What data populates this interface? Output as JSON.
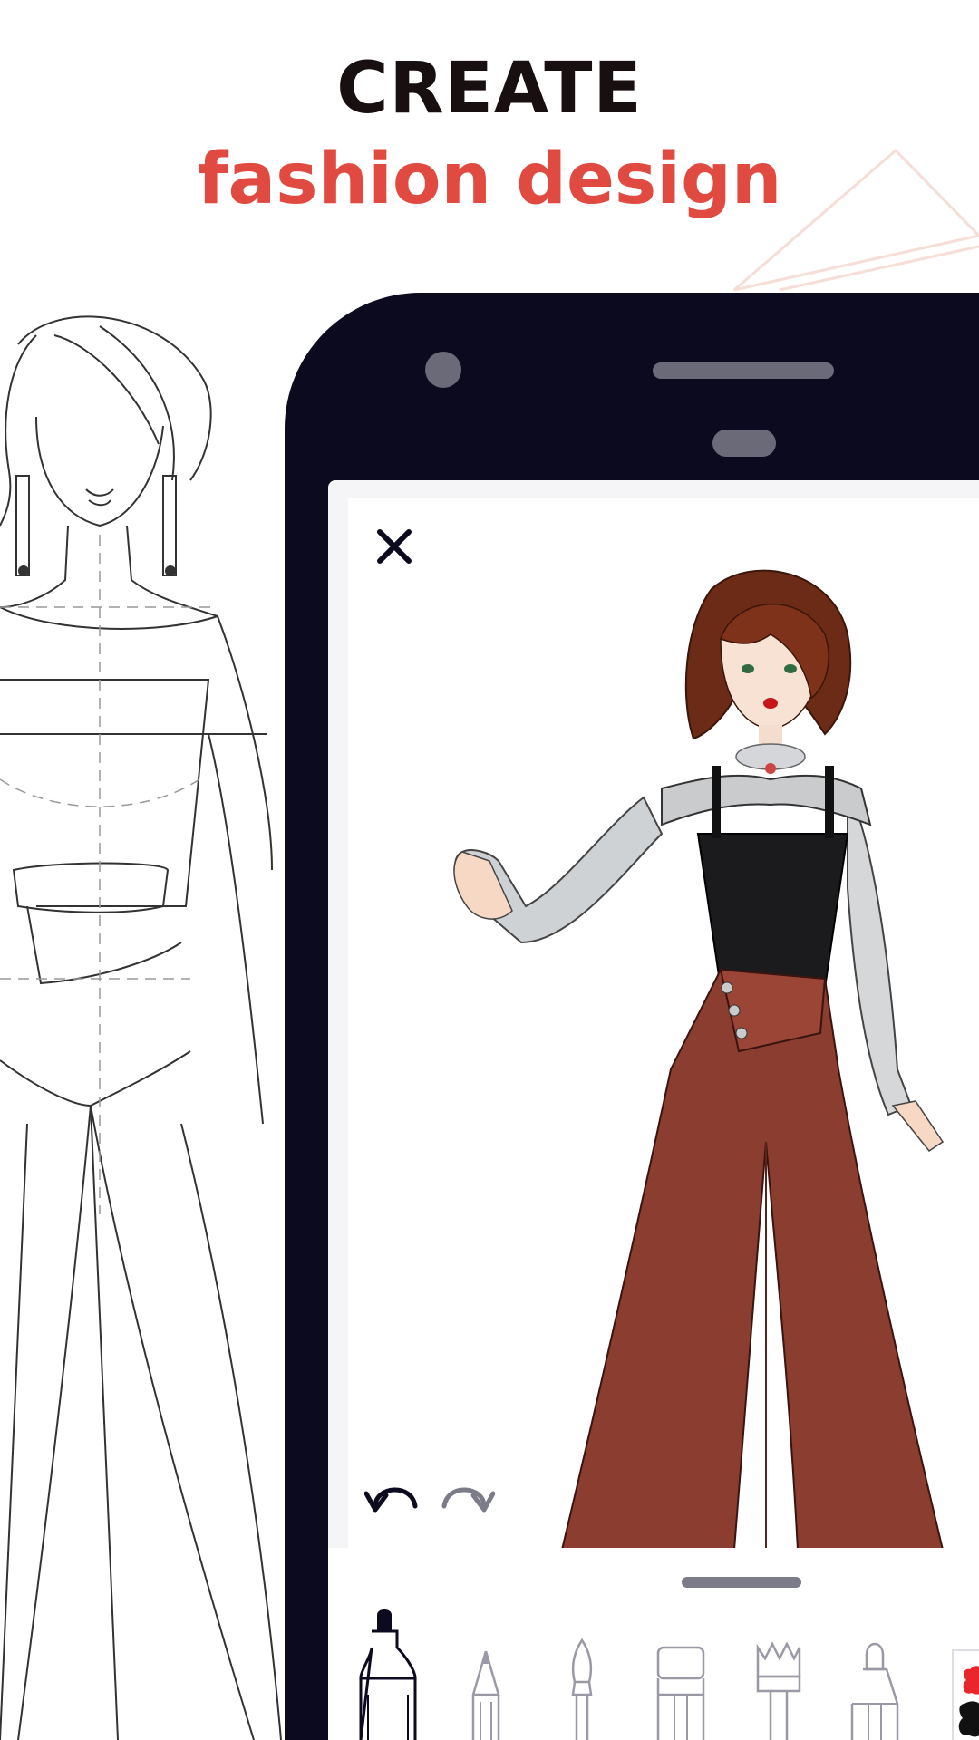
{
  "headline": {
    "line1": "CREATE",
    "line2": "fashion design"
  },
  "colors": {
    "headline_dark": "#170f10",
    "headline_accent": "#e04a40",
    "phone_body": "#0c0a1e",
    "pants": "#8b3d30",
    "sleeves": "#cfd2d4"
  },
  "canvas": {
    "icons": [
      "close-icon",
      "undo-icon",
      "redo-icon"
    ]
  },
  "toolbar": {
    "tools": [
      "marker",
      "pencil",
      "brush",
      "rectangle-marker",
      "flat-brush",
      "pen-nib"
    ],
    "selected_tool": "marker"
  }
}
